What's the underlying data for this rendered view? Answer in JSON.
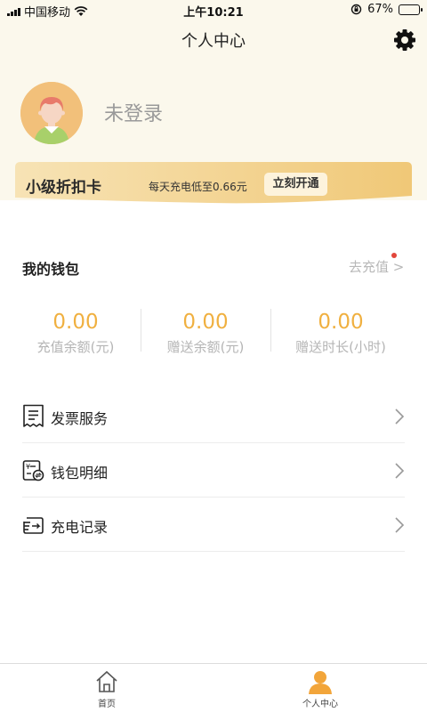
{
  "status_bar": {
    "carrier": "中国移动",
    "time": "上午10:21",
    "battery": "67%",
    "battery_level": 0.67
  },
  "header": {
    "title": "个人中心",
    "settings_icon": "gear-icon"
  },
  "profile": {
    "login_text": "未登录",
    "avatar_icon": "avatar"
  },
  "discount_card": {
    "title": "小级折扣卡",
    "description": "每天充电低至0.66元",
    "button_label": "立刻开通"
  },
  "wallet": {
    "title": "我的钱包",
    "recharge_link": "去充值 >",
    "stats": [
      {
        "value": "0.00",
        "label": "充值余额(元)"
      },
      {
        "value": "0.00",
        "label": "赠送余额(元)"
      },
      {
        "value": "0.00",
        "label": "赠送时长(小时)"
      }
    ]
  },
  "menu": [
    {
      "label": "发票服务",
      "icon": "invoice-icon"
    },
    {
      "label": "钱包明细",
      "icon": "wallet-detail-icon"
    },
    {
      "label": "充电记录",
      "icon": "charge-record-icon"
    }
  ],
  "tabbar": [
    {
      "label": "首页",
      "icon": "home-icon",
      "active": false
    },
    {
      "label": "个人中心",
      "icon": "user-icon",
      "active": true
    }
  ],
  "colors": {
    "accent": "#f0b040",
    "card_gradient_start": "#f7e3b5",
    "card_gradient_end": "#f0c877",
    "header_bg": "#fbf8ec",
    "active_tab": "#f2a53a"
  }
}
